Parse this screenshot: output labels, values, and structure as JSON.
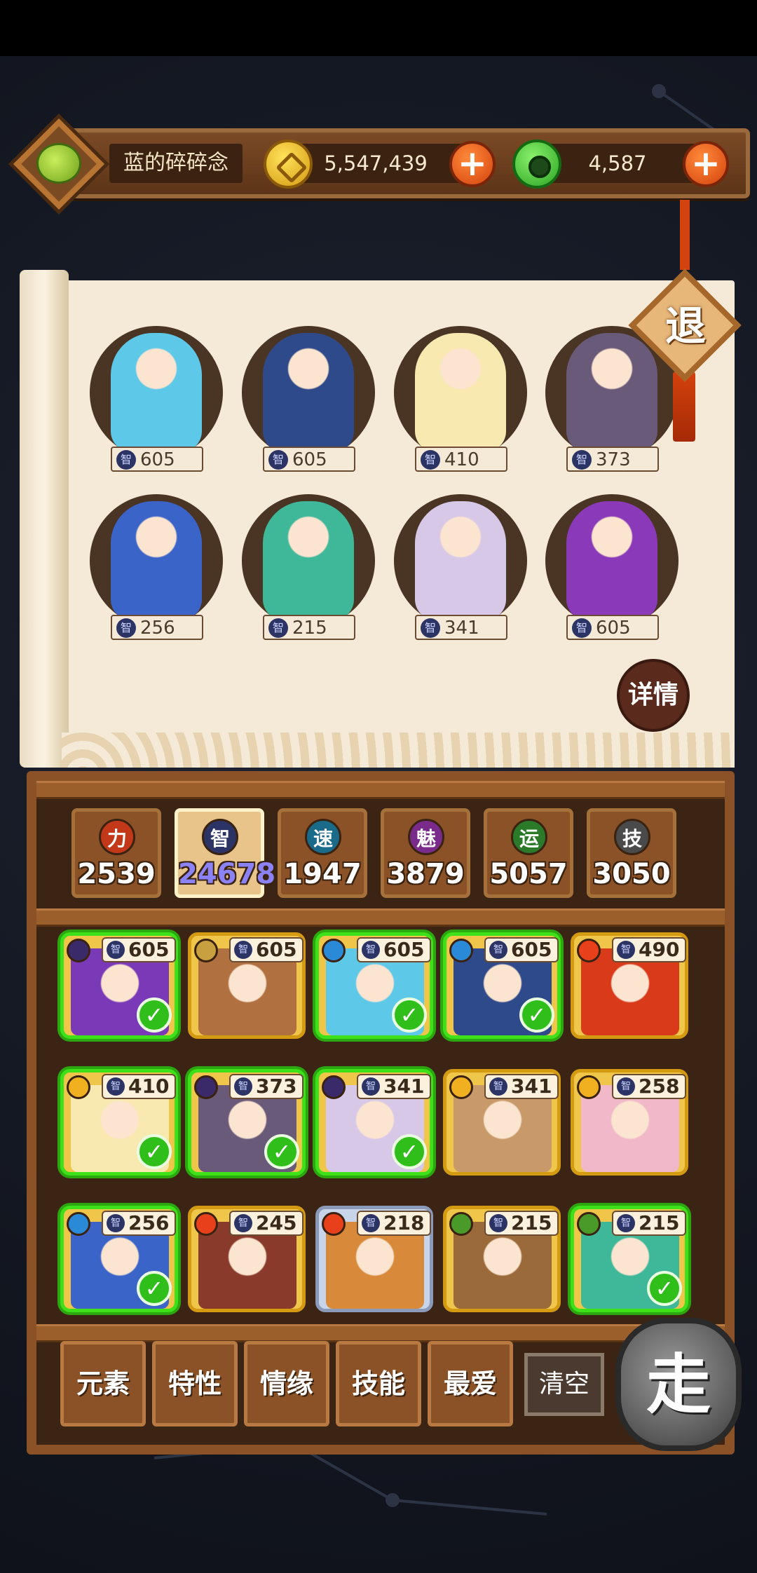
{
  "player": {
    "name": "蓝的碎碎念",
    "avatar_icon": "frog-avatar-icon"
  },
  "currency": {
    "coins": "5,547,439",
    "jade": "4,587"
  },
  "buttons": {
    "exit": "退",
    "detail": "详情",
    "go": "走",
    "clear": "清空"
  },
  "team": [
    {
      "value": "605",
      "stat_icon": "智",
      "color": "#5ec8e8"
    },
    {
      "value": "605",
      "stat_icon": "智",
      "color": "#2f4a8a"
    },
    {
      "value": "410",
      "stat_icon": "智",
      "color": "#f7e9b0"
    },
    {
      "value": "373",
      "stat_icon": "智",
      "color": "#6a5a7a"
    },
    {
      "value": "256",
      "stat_icon": "智",
      "color": "#3a64c8"
    },
    {
      "value": "215",
      "stat_icon": "智",
      "color": "#3fb89a"
    },
    {
      "value": "341",
      "stat_icon": "智",
      "color": "#d8c8e8"
    },
    {
      "value": "605",
      "stat_icon": "智",
      "color": "#8a3ab8"
    }
  ],
  "attributes": [
    {
      "icon": "力",
      "value": "2539",
      "color": "#c4381a",
      "selected": false
    },
    {
      "icon": "智",
      "value": "24678",
      "color": "#2c3466",
      "selected": true
    },
    {
      "icon": "速",
      "value": "1947",
      "color": "#1a6a8a",
      "selected": false
    },
    {
      "icon": "魅",
      "value": "3879",
      "color": "#7a2a8a",
      "selected": false
    },
    {
      "icon": "运",
      "value": "5057",
      "color": "#2a7a2a",
      "selected": false
    },
    {
      "icon": "技",
      "value": "3050",
      "color": "#4a4a4a",
      "selected": false
    }
  ],
  "roster": [
    {
      "value": "605",
      "element": "moon",
      "selected": true,
      "color": "#7a3ab8"
    },
    {
      "value": "605",
      "element": "earth",
      "selected": false,
      "color": "#b07040"
    },
    {
      "value": "605",
      "element": "water",
      "selected": true,
      "color": "#5ec8e8"
    },
    {
      "value": "605",
      "element": "water",
      "selected": true,
      "color": "#2f4a8a"
    },
    {
      "value": "490",
      "element": "fire",
      "selected": false,
      "color": "#d83a1a"
    },
    {
      "value": "410",
      "element": "sun",
      "selected": true,
      "color": "#f7e9b0"
    },
    {
      "value": "373",
      "element": "moon",
      "selected": true,
      "color": "#6a5a7a"
    },
    {
      "value": "341",
      "element": "moon",
      "selected": true,
      "color": "#d8c8e8"
    },
    {
      "value": "341",
      "element": "sun",
      "selected": false,
      "color": "#c89a6a"
    },
    {
      "value": "258",
      "element": "sun",
      "selected": false,
      "color": "#f0b8c8"
    },
    {
      "value": "256",
      "element": "water",
      "selected": true,
      "color": "#3a64c8"
    },
    {
      "value": "245",
      "element": "fire",
      "selected": false,
      "color": "#8a3a2a"
    },
    {
      "value": "218",
      "element": "fire",
      "selected": false,
      "color": "#d88a3a"
    },
    {
      "value": "215",
      "element": "wood",
      "selected": false,
      "color": "#9a6a3a"
    },
    {
      "value": "215",
      "element": "wood",
      "selected": true,
      "color": "#3fb89a"
    }
  ],
  "filters": [
    "元素",
    "特性",
    "情缘",
    "技能",
    "最爱"
  ]
}
